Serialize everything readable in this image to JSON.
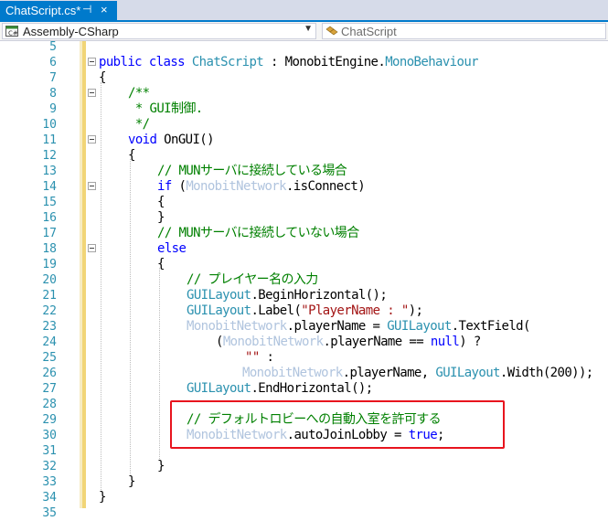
{
  "tab": {
    "title": "ChatScript.cs*",
    "pin": "⊣",
    "close": "×"
  },
  "navbar": {
    "project": "Assembly-CSharp",
    "class_placeholder": "ChatScript"
  },
  "colors": {
    "accent": "#007acc",
    "keyword": "#0000ff",
    "type": "#2b91af",
    "comment": "#008000",
    "string": "#a31515",
    "highlight": "#e8141e"
  },
  "lines": [
    {
      "n": "5"
    },
    {
      "n": "6"
    },
    {
      "n": "7"
    },
    {
      "n": "8"
    },
    {
      "n": "9"
    },
    {
      "n": "10"
    },
    {
      "n": "11"
    },
    {
      "n": "12"
    },
    {
      "n": "13"
    },
    {
      "n": "14"
    },
    {
      "n": "15"
    },
    {
      "n": "16"
    },
    {
      "n": "17"
    },
    {
      "n": "18"
    },
    {
      "n": "19"
    },
    {
      "n": "20"
    },
    {
      "n": "21"
    },
    {
      "n": "22"
    },
    {
      "n": "23"
    },
    {
      "n": "24"
    },
    {
      "n": "25"
    },
    {
      "n": "26"
    },
    {
      "n": "27"
    },
    {
      "n": "28"
    },
    {
      "n": "29"
    },
    {
      "n": "30"
    },
    {
      "n": "31"
    },
    {
      "n": "32"
    },
    {
      "n": "33"
    },
    {
      "n": "34"
    },
    {
      "n": "35"
    }
  ],
  "code": {
    "l6": {
      "kw1": "public",
      "kw2": "class",
      "cls": "ChatScript",
      "sep": " : MonobitEngine.",
      "base": "MonoBehaviour"
    },
    "l7": "{",
    "l8": "/**",
    "l9": " * GUI制御.",
    "l10": " */",
    "l11": {
      "kw": "void",
      "name": " OnGUI()"
    },
    "l12": "{",
    "l13": "// MUNサーバに接続している場合",
    "l14": {
      "kw": "if",
      "open": " (",
      "ty": "MonobitNetwork",
      "rest": ".isConnect)"
    },
    "l15": "{",
    "l16": "}",
    "l17": "// MUNサーバに接続していない場合",
    "l18": "else",
    "l19": "{",
    "l20": "// プレイヤー名の入力",
    "l21": {
      "ty": "GUILayout",
      "rest": ".BeginHorizontal();"
    },
    "l22": {
      "ty": "GUILayout",
      "mid": ".Label(",
      "str": "\"PlayerName : \"",
      "end": ");"
    },
    "l23": {
      "ty": "MonobitNetwork",
      "mid": ".playerName = ",
      "ty2": "GUILayout",
      "end": ".TextField("
    },
    "l24": {
      "open": "(",
      "ty": "MonobitNetwork",
      "mid": ".playerName == ",
      "kw": "null",
      "end": ") ?"
    },
    "l25": {
      "str": "\"\"",
      "end": " :"
    },
    "l26": {
      "ty": "MonobitNetwork",
      "mid": ".playerName, ",
      "ty2": "GUILayout",
      "end": ".Width(200));"
    },
    "l27": {
      "ty": "GUILayout",
      "rest": ".EndHorizontal();"
    },
    "l29": "// デフォルトロビーへの自動入室を許可する",
    "l30": {
      "ty": "MonobitNetwork",
      "mid": ".autoJoinLobby = ",
      "kw": "true",
      "end": ";"
    },
    "l32": "}",
    "l33": "}",
    "l34": "}"
  }
}
